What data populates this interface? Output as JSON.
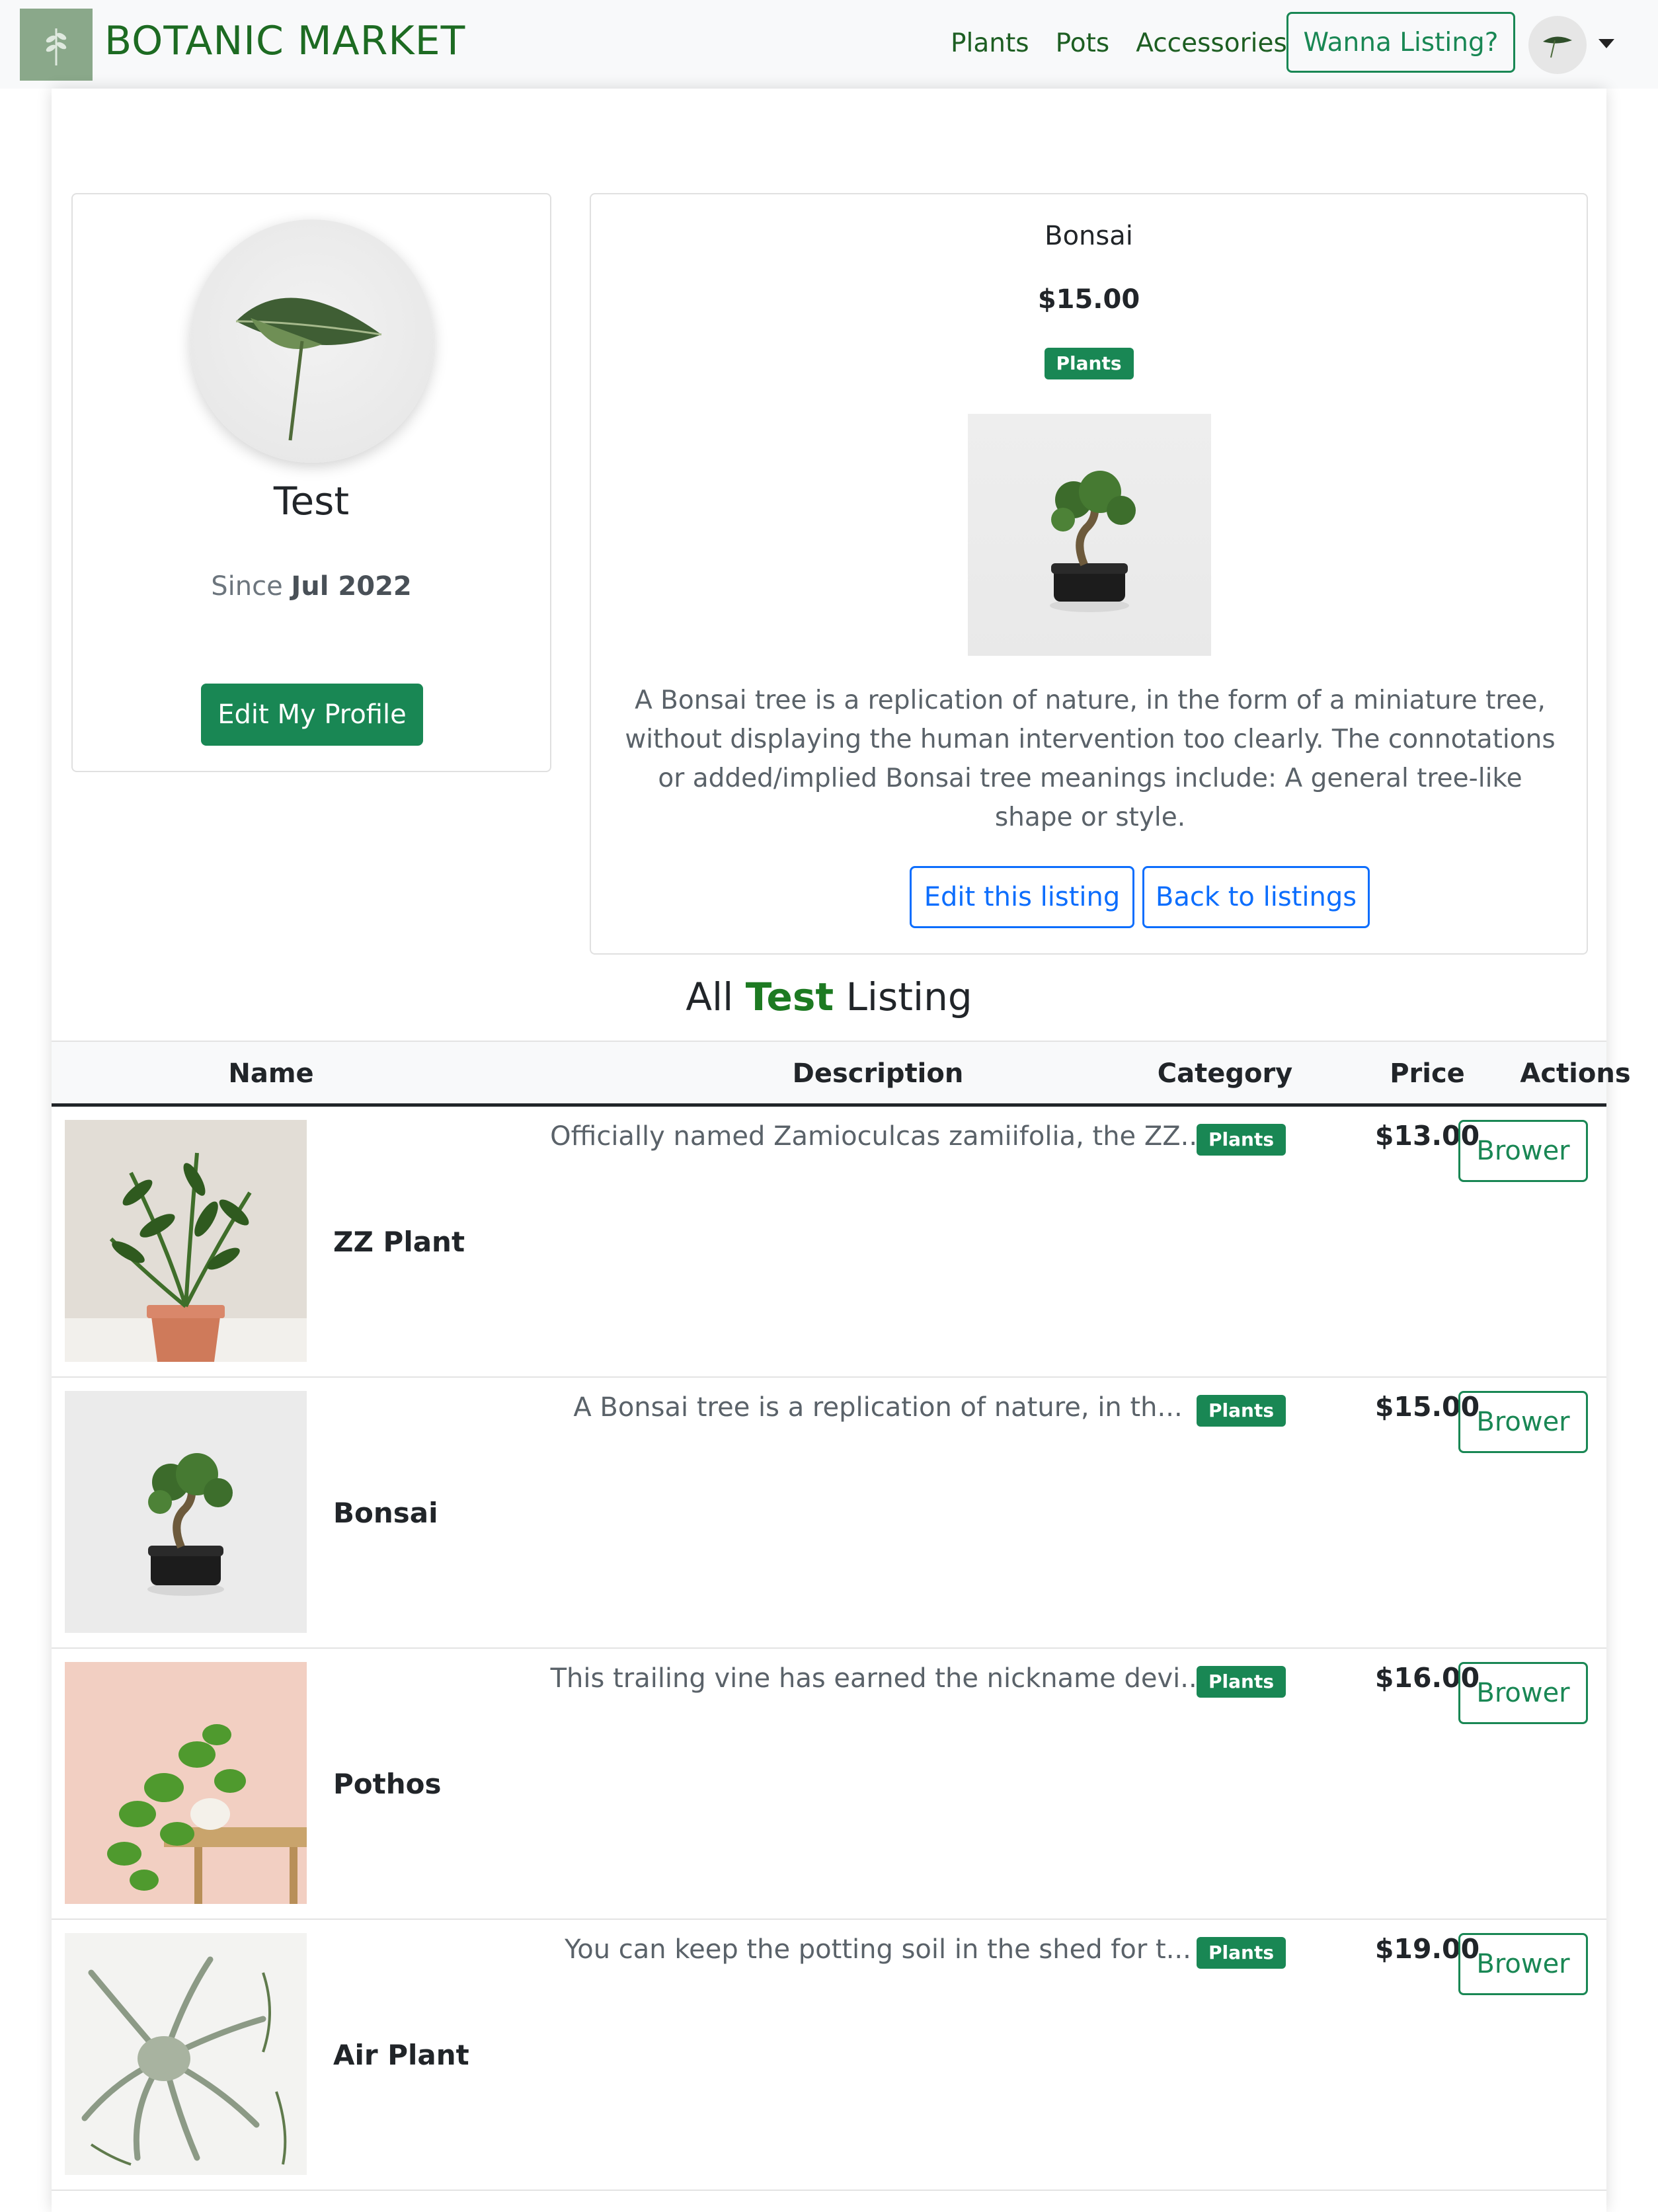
{
  "navbar": {
    "brand": "BOTANIC MARKET",
    "links": [
      "Plants",
      "Pots",
      "Accessories"
    ],
    "cta": "Wanna Listing?"
  },
  "profile": {
    "name": "Test",
    "since_prefix": "Since",
    "since_date": "Jul 2022",
    "edit_button": "Edit My Profile"
  },
  "listing": {
    "title": "Bonsai",
    "price": "$15.00",
    "category": "Plants",
    "description": "A Bonsai tree is a replication of nature, in the form of a miniature tree, without displaying the human intervention too clearly. The connotations or added/implied Bonsai tree meanings include: A general tree-like shape or style.",
    "edit_button": "Edit this listing",
    "back_button": "Back to listings"
  },
  "all_listings": {
    "heading_prefix": "All",
    "heading_user": "Test",
    "heading_suffix": "Listing",
    "columns": [
      "Name",
      "Description",
      "Category",
      "Price",
      "Actions"
    ],
    "rows": [
      {
        "name": "ZZ Plant",
        "description": "Officially named Zamioculcas zamiifolia, the ZZ...",
        "category": "Plants",
        "price": "$13.00",
        "action": "Brower"
      },
      {
        "name": "Bonsai",
        "description": "A Bonsai tree is a replication of nature, in th...",
        "category": "Plants",
        "price": "$15.00",
        "action": "Brower"
      },
      {
        "name": "Pothos",
        "description": "This trailing vine has earned the nickname devi...",
        "category": "Plants",
        "price": "$16.00",
        "action": "Brower"
      },
      {
        "name": "Air Plant",
        "description": "You can keep the potting soil in the shed for t...",
        "category": "Plants",
        "price": "$19.00",
        "action": "Brower"
      }
    ]
  },
  "colors": {
    "brand_green": "#1d6b22",
    "success": "#198754",
    "primary": "#0d6efd"
  },
  "icons": {
    "brand_logo": "leaf-sprig-icon",
    "user_avatar": "leaf-avatar-icon",
    "dropdown": "caret-down-icon"
  }
}
